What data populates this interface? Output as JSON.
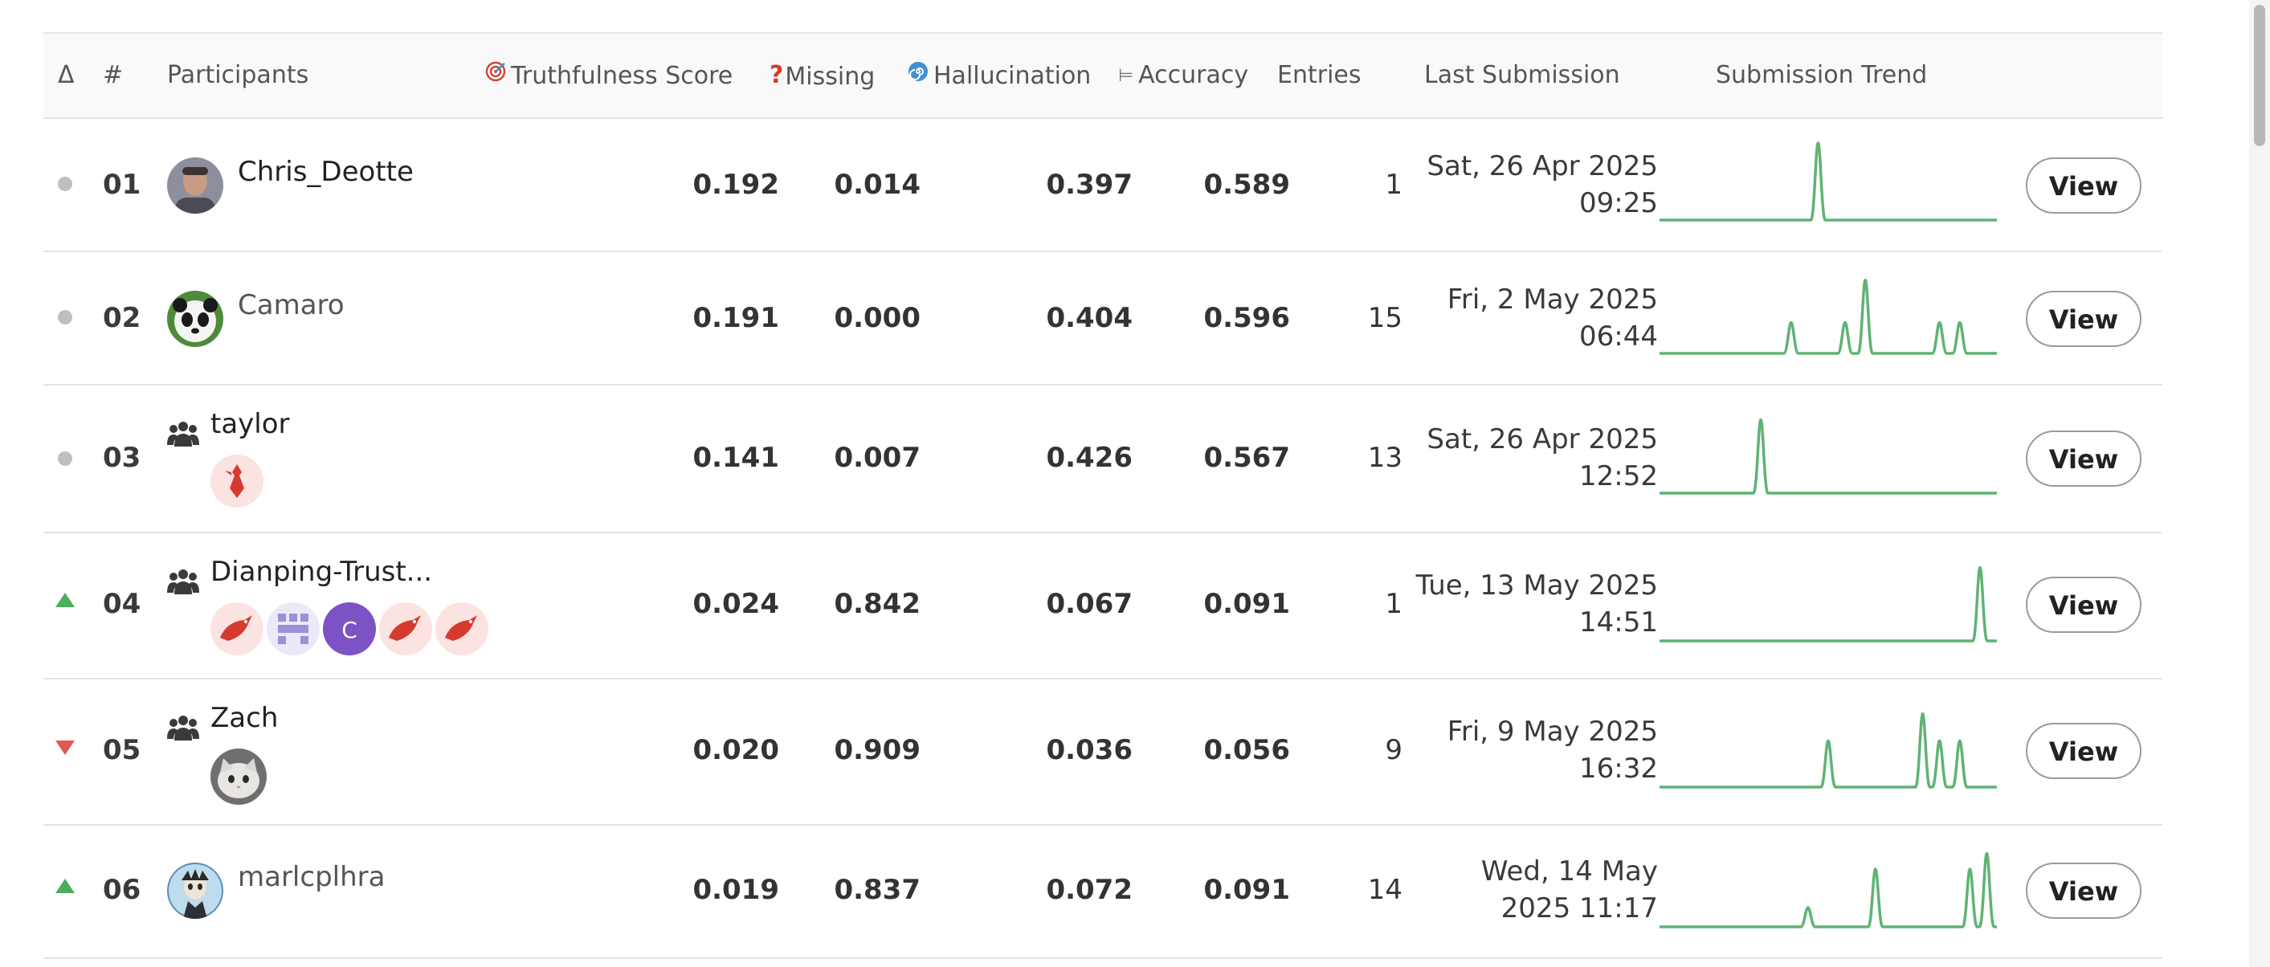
{
  "header": {
    "delta": "Δ",
    "rank": "#",
    "participants": "Participants",
    "truthfulness": "Truthfulness Score",
    "missing": "Missing",
    "hallucination": "Hallucination",
    "accuracy": "Accuracy",
    "entries": "Entries",
    "last_submission": "Last Submission",
    "trend": "Submission Trend"
  },
  "view_label": "View",
  "colors": {
    "trend": "#5fb374",
    "up": "#4cae5b",
    "down": "#e05a4f",
    "neutral": "#bfbfbf"
  },
  "rows": [
    {
      "delta": "neutral",
      "rank": "01",
      "name": "Chris_Deotte",
      "team": false,
      "truthfulness": "0.192",
      "missing": "0.014",
      "hallucination": "0.397",
      "accuracy": "0.589",
      "entries": "1",
      "date1": "Sat, 26 Apr 2025",
      "date2": "09:25",
      "trend": [
        [
          0.47,
          1.0
        ]
      ]
    },
    {
      "delta": "neutral",
      "rank": "02",
      "name": "Camaro",
      "team": false,
      "truthfulness": "0.191",
      "missing": "0.000",
      "hallucination": "0.404",
      "accuracy": "0.596",
      "entries": "15",
      "date1": "Fri, 2 May 2025",
      "date2": "06:44",
      "trend": [
        [
          0.39,
          0.4
        ],
        [
          0.55,
          0.4
        ],
        [
          0.61,
          0.95
        ],
        [
          0.83,
          0.4
        ],
        [
          0.89,
          0.4
        ]
      ]
    },
    {
      "delta": "neutral",
      "rank": "03",
      "name": "taylor",
      "team": true,
      "truthfulness": "0.141",
      "missing": "0.007",
      "hallucination": "0.426",
      "accuracy": "0.567",
      "entries": "13",
      "date1": "Sat, 26 Apr 2025",
      "date2": "12:52",
      "trend": [
        [
          0.3,
          0.95
        ]
      ]
    },
    {
      "delta": "up",
      "rank": "04",
      "name": "Dianping-Trust...",
      "team": true,
      "truthfulness": "0.024",
      "missing": "0.842",
      "hallucination": "0.067",
      "accuracy": "0.091",
      "entries": "1",
      "date1": "Tue, 13 May 2025",
      "date2": "14:51",
      "trend": [
        [
          0.95,
          0.95
        ]
      ]
    },
    {
      "delta": "down",
      "rank": "05",
      "name": "Zach",
      "team": true,
      "truthfulness": "0.020",
      "missing": "0.909",
      "hallucination": "0.036",
      "accuracy": "0.056",
      "entries": "9",
      "date1": "Fri, 9 May 2025",
      "date2": "16:32",
      "trend": [
        [
          0.5,
          0.6
        ],
        [
          0.78,
          0.95
        ],
        [
          0.83,
          0.6
        ],
        [
          0.89,
          0.6
        ]
      ]
    },
    {
      "delta": "up",
      "rank": "06",
      "name": "marlcplhra",
      "team": false,
      "truthfulness": "0.019",
      "missing": "0.837",
      "hallucination": "0.072",
      "accuracy": "0.091",
      "entries": "14",
      "date1": "Wed, 14 May",
      "date2": "2025 11:17",
      "trend": [
        [
          0.44,
          0.25
        ],
        [
          0.64,
          0.75
        ],
        [
          0.92,
          0.75
        ],
        [
          0.97,
          0.95
        ]
      ]
    }
  ]
}
